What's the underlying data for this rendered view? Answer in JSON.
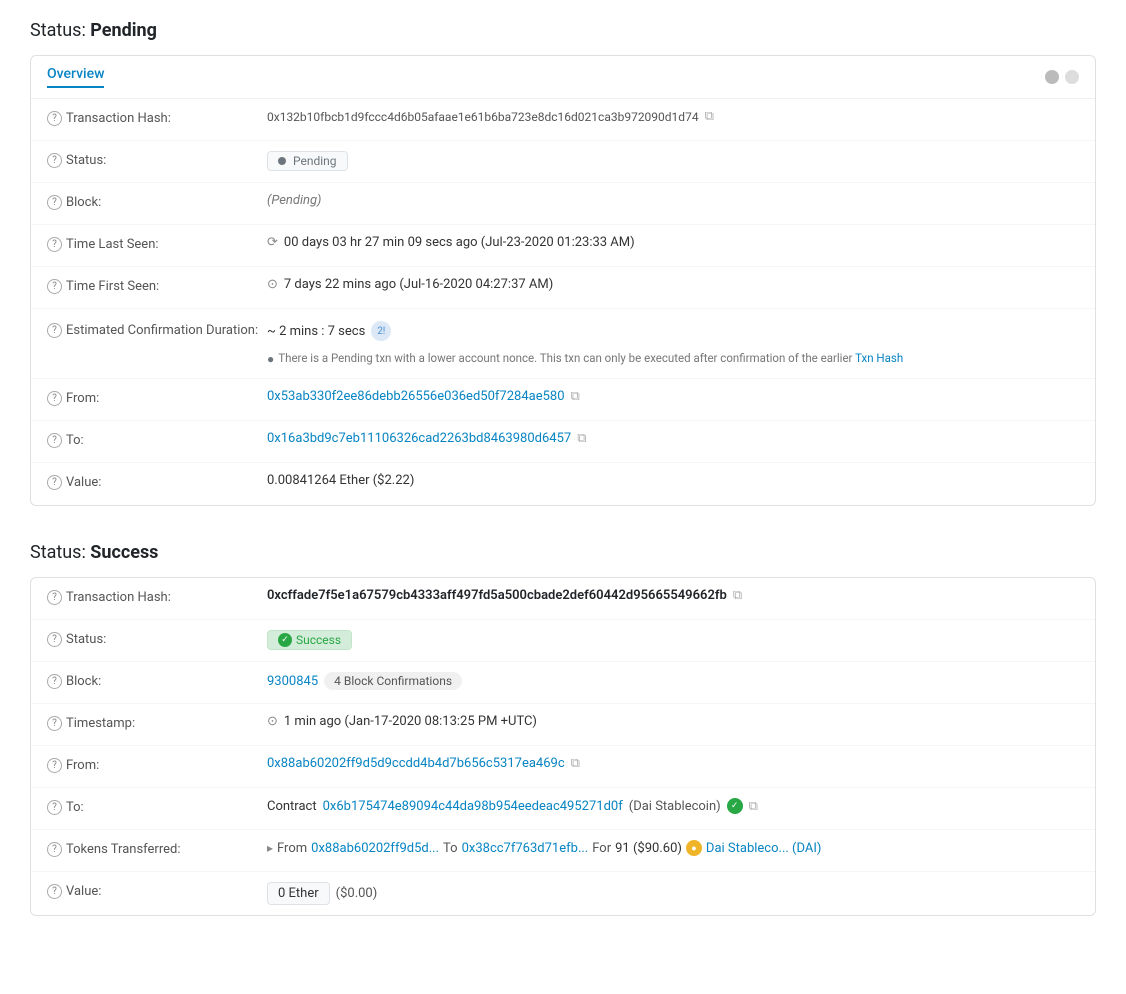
{
  "pending": {
    "section_title": "Status:",
    "section_status": "Pending",
    "tab_label": "Overview",
    "rows": [
      {
        "label": "Transaction Hash:",
        "value": "0x132b10fbcb1d9fccc4d6b05afaae1e61b6ba723e8dc16d021ca3b972090d1d74",
        "type": "hash_copy"
      },
      {
        "label": "Status:",
        "value": "Pending",
        "type": "badge_pending"
      },
      {
        "label": "Block:",
        "value": "(Pending)",
        "type": "italic"
      },
      {
        "label": "Time Last Seen:",
        "value": "00 days 03 hr 27 min 09 secs ago (Jul-23-2020 01:23:33 AM)",
        "type": "time"
      },
      {
        "label": "Time First Seen:",
        "value": "7 days 22 mins ago (Jul-16-2020 04:27:37 AM)",
        "type": "time"
      },
      {
        "label": "Estimated Confirmation Duration:",
        "value": "~ 2 mins : 7 secs",
        "note": "There is a Pending txn with a lower account nonce. This txn can only be executed after confirmation of the earlier Txn Hash",
        "type": "duration"
      },
      {
        "label": "From:",
        "value": "0x53ab330f2ee86debb26556e036ed50f7284ae580",
        "type": "link_copy"
      },
      {
        "label": "To:",
        "value": "0x16a3bd9c7eb11106326cad2263bd8463980d6457",
        "type": "link_copy"
      },
      {
        "label": "Value:",
        "value": "0.00841264 Ether ($2.22)",
        "type": "plain"
      }
    ]
  },
  "success": {
    "section_title": "Status:",
    "section_status": "Success",
    "rows": [
      {
        "label": "Transaction Hash:",
        "value": "0xcffade7f5e1a67579cb4333aff497fd5a500cbade2def60442d95665549662fb",
        "type": "hash_copy_bold"
      },
      {
        "label": "Status:",
        "value": "Success",
        "type": "badge_success"
      },
      {
        "label": "Block:",
        "block_number": "9300845",
        "confirmations": "4 Block Confirmations",
        "type": "block"
      },
      {
        "label": "Timestamp:",
        "value": "1 min ago (Jan-17-2020 08:13:25 PM +UTC)",
        "type": "time"
      },
      {
        "label": "From:",
        "value": "0x88ab60202ff9d5d9ccdd4b4d7b656c5317ea469c",
        "type": "link_copy"
      },
      {
        "label": "To:",
        "contract_prefix": "Contract",
        "contract_address": "0x6b175474e89094c44da98b954eedeac495271d0f",
        "contract_name": "(Dai Stablecoin)",
        "type": "contract"
      },
      {
        "label": "Tokens Transferred:",
        "from_addr": "0x88ab60202ff9d5d...",
        "to_addr": "0x38cc7f763d71efb...",
        "amount": "91 ($90.60)",
        "token_name": "Dai Stableco... (DAI)",
        "type": "tokens"
      },
      {
        "label": "Value:",
        "value": "0 Ether",
        "extra": "($0.00)",
        "type": "value_box"
      }
    ]
  },
  "labels": {
    "transaction_hash": "Transaction Hash:",
    "status": "Status:",
    "block": "Block:",
    "time_last_seen": "Time Last Seen:",
    "time_first_seen": "Time First Seen:",
    "est_confirmation": "Estimated Confirmation Duration:",
    "timestamp": "Timestamp:",
    "from": "From:",
    "to": "To:",
    "value": "Value:",
    "tokens_transferred": "Tokens Transferred:"
  }
}
